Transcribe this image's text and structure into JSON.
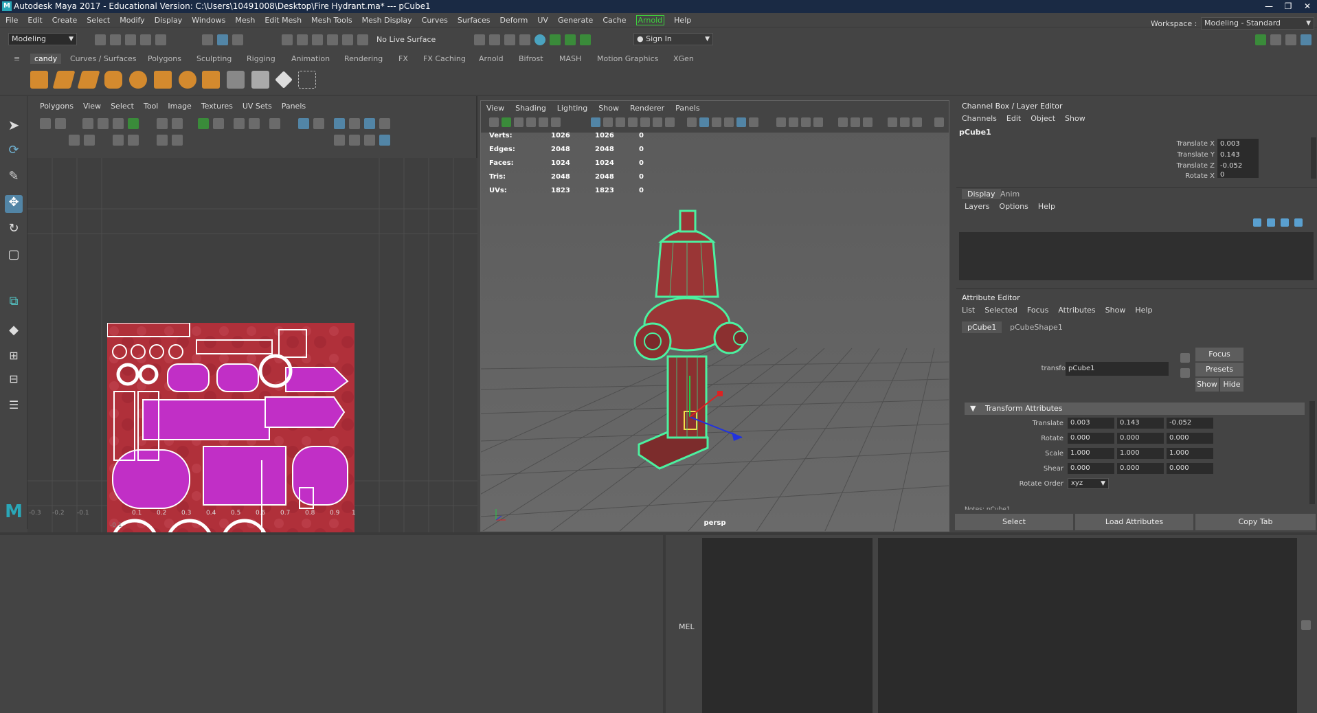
{
  "window": {
    "title": "Autodesk Maya 2017 - Educational Version: C:\\Users\\10491008\\Desktop\\Fire Hydrant.ma*  ---  pCube1",
    "controls": [
      "—",
      "❐",
      "✕"
    ]
  },
  "menubar": [
    "File",
    "Edit",
    "Create",
    "Select",
    "Modify",
    "Display",
    "Windows",
    "Mesh",
    "Edit Mesh",
    "Mesh Tools",
    "Mesh Display",
    "Curves",
    "Surfaces",
    "Deform",
    "UV",
    "Generate",
    "Cache",
    "Arnold",
    "Help"
  ],
  "statusline": {
    "mode": "Modeling",
    "live_surface": "No Live Surface",
    "sign_in": "Sign In",
    "workspace_label": "Workspace :",
    "workspace_value": "Modeling - Standard"
  },
  "shelf": {
    "tabs": [
      "candy",
      "Curves / Surfaces",
      "Polygons",
      "Sculpting",
      "Rigging",
      "Animation",
      "Rendering",
      "FX",
      "FX Caching",
      "Arnold",
      "Bifrost",
      "MASH",
      "Motion Graphics",
      "XGen"
    ],
    "active_tab": "candy"
  },
  "uv_editor": {
    "menu": [
      "Polygons",
      "View",
      "Select",
      "Tool",
      "Image",
      "Textures",
      "UV Sets",
      "Panels"
    ],
    "axis_ticks": [
      "-0.3",
      "-0.2",
      "-0.1",
      "0.1",
      "0.2",
      "0.3",
      "0.4",
      "0.5",
      "0.6",
      "0.7",
      "0.8",
      "0.9",
      "1"
    ],
    "bottom_tick": "-0.1"
  },
  "viewport": {
    "menu": [
      "View",
      "Shading",
      "Lighting",
      "Show",
      "Renderer",
      "Panels"
    ],
    "hud": [
      {
        "label": "Verts:",
        "a": "1026",
        "b": "1026",
        "c": "0"
      },
      {
        "label": "Edges:",
        "a": "2048",
        "b": "2048",
        "c": "0"
      },
      {
        "label": "Faces:",
        "a": "1024",
        "b": "1024",
        "c": "0"
      },
      {
        "label": "Tris:",
        "a": "2048",
        "b": "2048",
        "c": "0"
      },
      {
        "label": "UVs:",
        "a": "1823",
        "b": "1823",
        "c": "0"
      }
    ],
    "camera": "persp"
  },
  "channel_box": {
    "title": "Channel Box / Layer Editor",
    "menu": [
      "Channels",
      "Edit",
      "Object",
      "Show"
    ],
    "object": "pCube1",
    "channels": [
      {
        "label": "Translate X",
        "value": "0.003"
      },
      {
        "label": "Translate Y",
        "value": "0.143"
      },
      {
        "label": "Translate Z",
        "value": "-0.052"
      },
      {
        "label": "Rotate X",
        "value": "0"
      }
    ]
  },
  "layer_editor": {
    "tabs": [
      "Display",
      "Anim"
    ],
    "menu": [
      "Layers",
      "Options",
      "Help"
    ]
  },
  "attribute_editor": {
    "title": "Attribute Editor",
    "menu": [
      "List",
      "Selected",
      "Focus",
      "Attributes",
      "Show",
      "Help"
    ],
    "node_tabs": [
      "pCube1",
      "pCubeShape1"
    ],
    "transform_label": "transform:",
    "transform_value": "pCube1",
    "buttons": {
      "focus": "Focus",
      "presets": "Presets",
      "show": "Show",
      "hide": "Hide"
    },
    "section": "Transform Attributes",
    "rows": [
      {
        "label": "Translate",
        "values": [
          "0.003",
          "0.143",
          "-0.052"
        ]
      },
      {
        "label": "Rotate",
        "values": [
          "0.000",
          "0.000",
          "0.000"
        ]
      },
      {
        "label": "Scale",
        "values": [
          "1.000",
          "1.000",
          "1.000"
        ]
      },
      {
        "label": "Shear",
        "values": [
          "0.000",
          "0.000",
          "0.000"
        ]
      }
    ],
    "rotate_order_label": "Rotate Order",
    "rotate_order_value": "xyz",
    "notes_label": "Notes: pCube1",
    "footer": [
      "Select",
      "Load Attributes",
      "Copy Tab"
    ]
  },
  "command_line": {
    "label": "MEL"
  }
}
